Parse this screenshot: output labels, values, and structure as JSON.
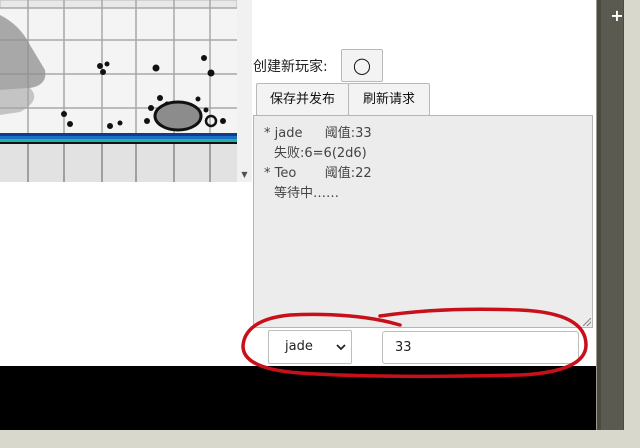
{
  "controls": {
    "create_player_label": "创建新玩家:",
    "create_player_button_glyph": "◯",
    "save_publish_label": "保存并发布",
    "refresh_label": "刷新请求"
  },
  "log": {
    "entries": [
      {
        "bullet": "*",
        "name": "jade",
        "detail": "阈值:33"
      },
      {
        "bullet": "",
        "name": "",
        "detail": "失败:6=6(2d6)"
      },
      {
        "bullet": "*",
        "name": "Teo",
        "detail": "阈值:22"
      },
      {
        "bullet": "",
        "name": "",
        "detail": "等待中……"
      }
    ]
  },
  "player_select": {
    "selected": "jade",
    "options": [
      "jade"
    ]
  },
  "value_input": {
    "value": "33"
  },
  "side_panel": {
    "plus_glyph": "+"
  },
  "colors": {
    "annotation_red": "#c8101a",
    "panel_bg": "#ececec",
    "sidebar_dark": "#4a4a42",
    "map_accent_blue": "#1d6fc4",
    "map_accent_teal": "#1fb3a8"
  },
  "icons": {
    "map_scroll_down": "triangle-down-icon",
    "select_chevron": "chevron-down-icon",
    "sidebar_add": "plus-icon",
    "log_resize": "resize-grip-icon"
  }
}
